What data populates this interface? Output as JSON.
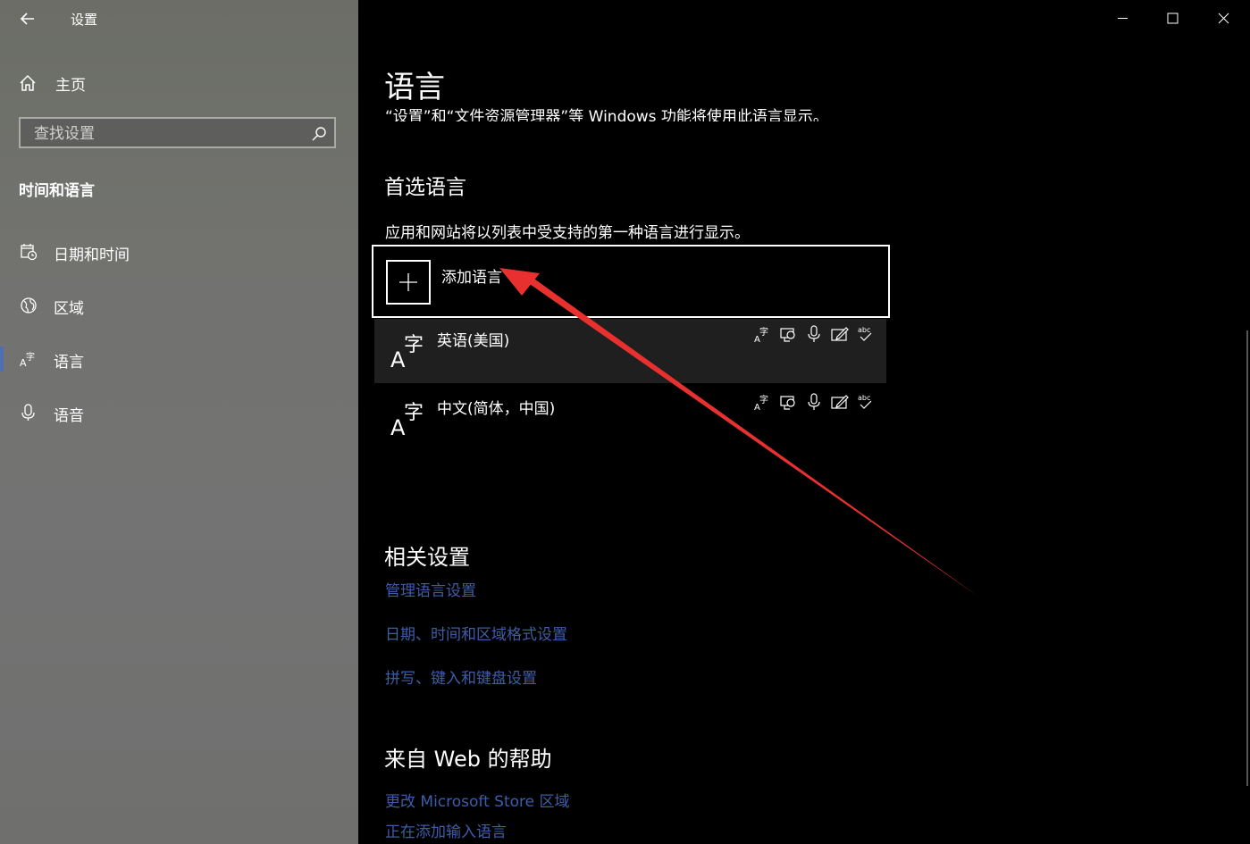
{
  "window": {
    "app_title": "设置"
  },
  "sidebar": {
    "home_label": "主页",
    "search": {
      "placeholder": "查找设置"
    },
    "section_title": "时间和语言",
    "items": [
      {
        "label": "日期和时间",
        "icon": "calendar-clock-icon"
      },
      {
        "label": "区域",
        "icon": "globe-icon"
      },
      {
        "label": "语言",
        "icon": "language-icon",
        "active": true
      },
      {
        "label": "语音",
        "icon": "microphone-icon"
      }
    ]
  },
  "main": {
    "title": "语言",
    "clipped_text": "“设置”和“文件资源管理器”等 Windows 功能将使用此语言显示。",
    "preferred_heading": "首选语言",
    "preferred_desc": "应用和网站将以列表中受支持的第一种语言进行显示。",
    "add_language_label": "添加语言",
    "languages": [
      {
        "name": "英语(美国)"
      },
      {
        "name": "中文(简体，中国)"
      }
    ],
    "related_heading": "相关设置",
    "related_links": [
      "管理语言设置",
      "日期、时间和区域格式设置",
      "拼写、键入和键盘设置"
    ],
    "help_heading": "来自 Web 的帮助",
    "help_links": [
      "更改 Microsoft Store 区域",
      "正在添加输入语言"
    ]
  },
  "colors": {
    "accent": "#4f6fb2",
    "link": "#3e5da8",
    "arrow": "#e8312f"
  }
}
